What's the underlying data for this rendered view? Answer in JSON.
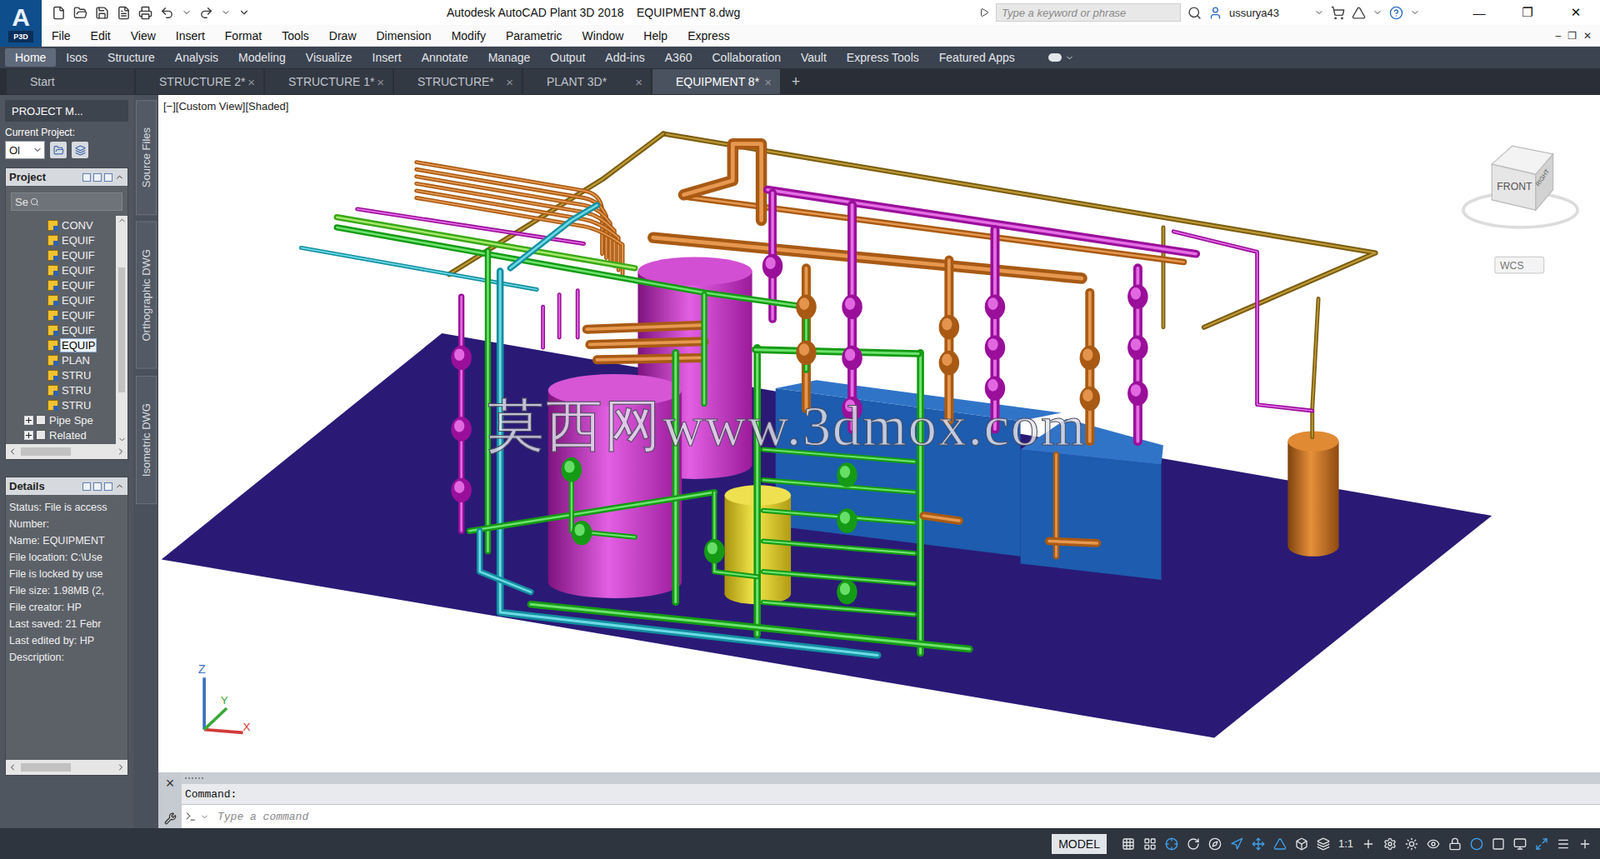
{
  "window": {
    "logo": "A",
    "logo_sub": "P3D",
    "title": "Autodesk AutoCAD Plant 3D 2018    EQUIPMENT 8.dwg",
    "search_placeholder": "Type a keyword or phrase",
    "user": "ussurya43",
    "controls": [
      "—",
      "❐",
      "✕"
    ]
  },
  "menu": [
    "File",
    "Edit",
    "View",
    "Insert",
    "Format",
    "Tools",
    "Draw",
    "Dimension",
    "Modify",
    "Parametric",
    "Window",
    "Help",
    "Express"
  ],
  "menu_controls": [
    "–",
    "❐",
    "✕"
  ],
  "ribbon_tabs": [
    {
      "label": "Home",
      "selected": true
    },
    {
      "label": "Isos",
      "selected": false
    },
    {
      "label": "Structure",
      "selected": false
    },
    {
      "label": "Analysis",
      "selected": false
    },
    {
      "label": "Modeling",
      "selected": false
    },
    {
      "label": "Visualize",
      "selected": false
    },
    {
      "label": "Insert",
      "selected": false
    },
    {
      "label": "Annotate",
      "selected": false
    },
    {
      "label": "Manage",
      "selected": false
    },
    {
      "label": "Output",
      "selected": false
    },
    {
      "label": "Add-ins",
      "selected": false
    },
    {
      "label": "A360",
      "selected": false
    },
    {
      "label": "Collaboration",
      "selected": false
    },
    {
      "label": "Vault",
      "selected": false
    },
    {
      "label": "Express Tools",
      "selected": false
    },
    {
      "label": "Featured Apps",
      "selected": false
    }
  ],
  "file_tabs": [
    {
      "label": "Start",
      "selected": false,
      "closable": false
    },
    {
      "label": "STRUCTURE 2*",
      "selected": false,
      "closable": true
    },
    {
      "label": "STRUCTURE 1*",
      "selected": false,
      "closable": true
    },
    {
      "label": "STRUCTURE*",
      "selected": false,
      "closable": true
    },
    {
      "label": "PLANT 3D*",
      "selected": false,
      "closable": true
    },
    {
      "label": "EQUIPMENT 8*",
      "selected": true,
      "closable": true
    }
  ],
  "tab_close": "×",
  "new_tab": "+",
  "project_manager": {
    "title": "PROJECT M...",
    "current_project_label": "Current Project:",
    "project_value": "Ol",
    "tree_title": "Project",
    "search_placeholder": "Se",
    "tree_items": [
      {
        "label": "CONV",
        "kind": "file",
        "selected": false
      },
      {
        "label": "EQUIF",
        "kind": "file",
        "selected": false
      },
      {
        "label": "EQUIF",
        "kind": "file",
        "selected": false
      },
      {
        "label": "EQUIF",
        "kind": "file",
        "selected": false
      },
      {
        "label": "EQUIF",
        "kind": "file",
        "selected": false
      },
      {
        "label": "EQUIF",
        "kind": "file",
        "selected": false
      },
      {
        "label": "EQUIF",
        "kind": "file",
        "selected": false
      },
      {
        "label": "EQUIF",
        "kind": "file",
        "selected": false
      },
      {
        "label": "EQUIP",
        "kind": "file",
        "selected": true
      },
      {
        "label": "PLAN",
        "kind": "file",
        "selected": false
      },
      {
        "label": "STRU",
        "kind": "file",
        "selected": false
      },
      {
        "label": "STRU",
        "kind": "file",
        "selected": false
      },
      {
        "label": "STRU",
        "kind": "file",
        "selected": false
      },
      {
        "label": "Pipe Spe",
        "kind": "group",
        "expanded": false,
        "selected": false
      },
      {
        "label": "Related",
        "kind": "group",
        "expanded": false,
        "selected": false
      }
    ]
  },
  "side_tabs": [
    "Source Files",
    "Orthographic DWG",
    "Isometric DWG"
  ],
  "details": {
    "title": "Details",
    "lines": [
      "Status: File is access",
      "Number:",
      "Name: EQUIPMENT",
      "File location: C:\\Use",
      "File is locked by use",
      "File size: 1.98MB (2,",
      "File creator: HP",
      "Last saved: 21 Febr",
      "Last edited by: HP",
      "Description:"
    ]
  },
  "viewport": {
    "label": "[−][Custom View][Shaded]",
    "watermark": "莫西网www.3dmox.com",
    "viewcube": {
      "front": "FRONT",
      "right": "RIGHT"
    },
    "wcs": "WCS",
    "axes": {
      "z": "Z",
      "y": "Y",
      "x": "X"
    }
  },
  "command": {
    "close": "×",
    "history": "Command:",
    "placeholder": "Type a command"
  },
  "status_bar": {
    "mode": "MODEL",
    "scale": "1:1",
    "toggles": [
      {
        "on": false
      },
      {
        "on": false
      },
      {
        "on": true
      },
      {
        "on": false
      },
      {
        "on": false
      },
      {
        "on": true
      },
      {
        "on": true
      },
      {
        "on": true
      },
      {
        "on": false
      },
      {
        "on": false
      },
      {
        "on": false
      },
      {
        "on": false
      },
      {
        "on": false
      },
      {
        "on": false
      },
      {
        "on": false
      },
      {
        "on": true
      },
      {
        "on": false
      },
      {
        "on": false
      },
      {
        "on": true
      },
      {
        "on": false
      },
      {
        "on": false
      }
    ]
  }
}
